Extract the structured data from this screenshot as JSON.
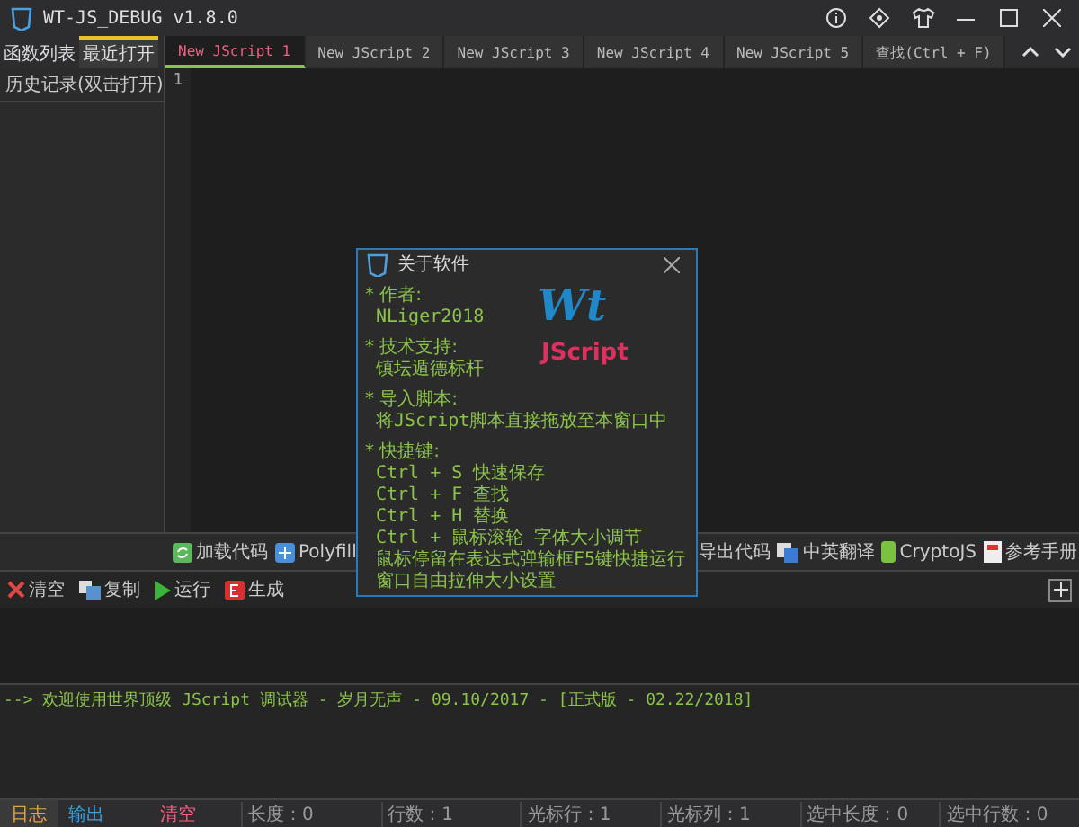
{
  "window": {
    "title": "WT-JS_DEBUG v1.8.0"
  },
  "sidebar": {
    "tabs": [
      {
        "label": "函数列表",
        "selected": false
      },
      {
        "label": "最近打开",
        "selected": true
      }
    ],
    "items": [
      "历史记录(双击打开)"
    ]
  },
  "editor_tabs": [
    {
      "label": "New JScript 1",
      "selected": true
    },
    {
      "label": "New JScript 2",
      "selected": false
    },
    {
      "label": "New JScript 3",
      "selected": false
    },
    {
      "label": "New JScript 4",
      "selected": false
    },
    {
      "label": "New JScript 5",
      "selected": false
    },
    {
      "label": "查找(Ctrl + F)",
      "selected": false
    }
  ],
  "editor": {
    "line_numbers": [
      "1"
    ]
  },
  "toolbar": [
    "加载代码",
    "Polyfill",
    "导出代码",
    "中英翻译",
    "CryptoJS",
    "参考手册"
  ],
  "output_toolbar": [
    "清空",
    "复制",
    "运行",
    "生成"
  ],
  "log": [
    "--> 欢迎使用世界顶级 JScript 调试器 - 岁月无声 - 09.10/2017 - [正式版 - 02.22/2018]"
  ],
  "bottom_tabs": [
    {
      "label": "日志",
      "selected": true
    },
    {
      "label": "输出",
      "selected": false
    }
  ],
  "clear_label": "清空",
  "status_bar": [
    "长度：0",
    "行数：1",
    "光标行：1",
    "光标列：1",
    "选中长度：0",
    "选中行数：0"
  ],
  "dialog": {
    "title": "关于软件",
    "logo": {
      "line1": "Wt",
      "line2": "JScript"
    },
    "sections": [
      {
        "heading": "* 作者:",
        "lines": [
          "NLiger2018"
        ]
      },
      {
        "heading": "* 技术支持:",
        "lines": [
          "镇坛遁德标杆"
        ]
      },
      {
        "heading": "* 导入脚本:",
        "lines": [
          "将JScript脚本直接拖放至本窗口中"
        ]
      },
      {
        "heading": "* 快捷键:",
        "lines": [
          "Ctrl + S 快速保存",
          "Ctrl + F 查找",
          "Ctrl + H 替换",
          "Ctrl + 鼠标滚轮 字体大小调节",
          "鼠标停留在表达式弹输框F5键快捷运行",
          "窗口自由拉伸大小设置"
        ]
      }
    ]
  }
}
